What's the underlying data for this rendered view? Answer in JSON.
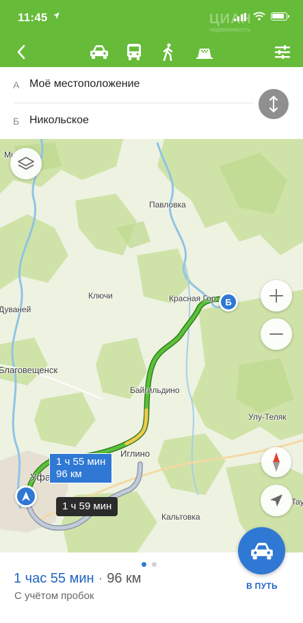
{
  "status_bar": {
    "time": "11:45",
    "watermark_big": "ЦИАН",
    "watermark_small": "недвижимость"
  },
  "nav": {
    "back_icon": "chevron-left-icon",
    "modes": [
      "car-icon",
      "bus-icon",
      "walk-icon",
      "taxi-icon"
    ],
    "selected_mode": "car",
    "settings_icon": "sliders-icon"
  },
  "route_inputs": {
    "from_letter": "А",
    "from_value": "Моё местоположение",
    "to_letter": "Б",
    "to_value": "Никольское"
  },
  "map": {
    "labels": {
      "mishkino": "Ми",
      "pavlovka": "Павловка",
      "klyuchi": "Ключи",
      "krasnaya_gorka": "Красная Гор",
      "duvaney": "Дуваней",
      "blagoveshchensk": "Благовещенск",
      "baigildino": "Байгильдино",
      "ulu_telyak": "Улу-Теляк",
      "iglino": "Иглино",
      "ufa": "Уфа",
      "kaltovka": "Кальтовка",
      "tau": "Tay"
    },
    "route_main_time": "1 ч 55 мин",
    "route_main_distance": "96 км",
    "route_alt_time": "1 ч 59 мин",
    "pin_end_letter": "Б",
    "route_colors": {
      "main": "#5cc03a",
      "slow": "#f2c94c",
      "alt": "#a8b4c7"
    }
  },
  "summary": {
    "duration": "1 час 55 мин",
    "distance": "96 км",
    "note": "С учётом пробок",
    "go_label": "В ПУТЬ",
    "page_count": 2,
    "active_page": 1
  }
}
